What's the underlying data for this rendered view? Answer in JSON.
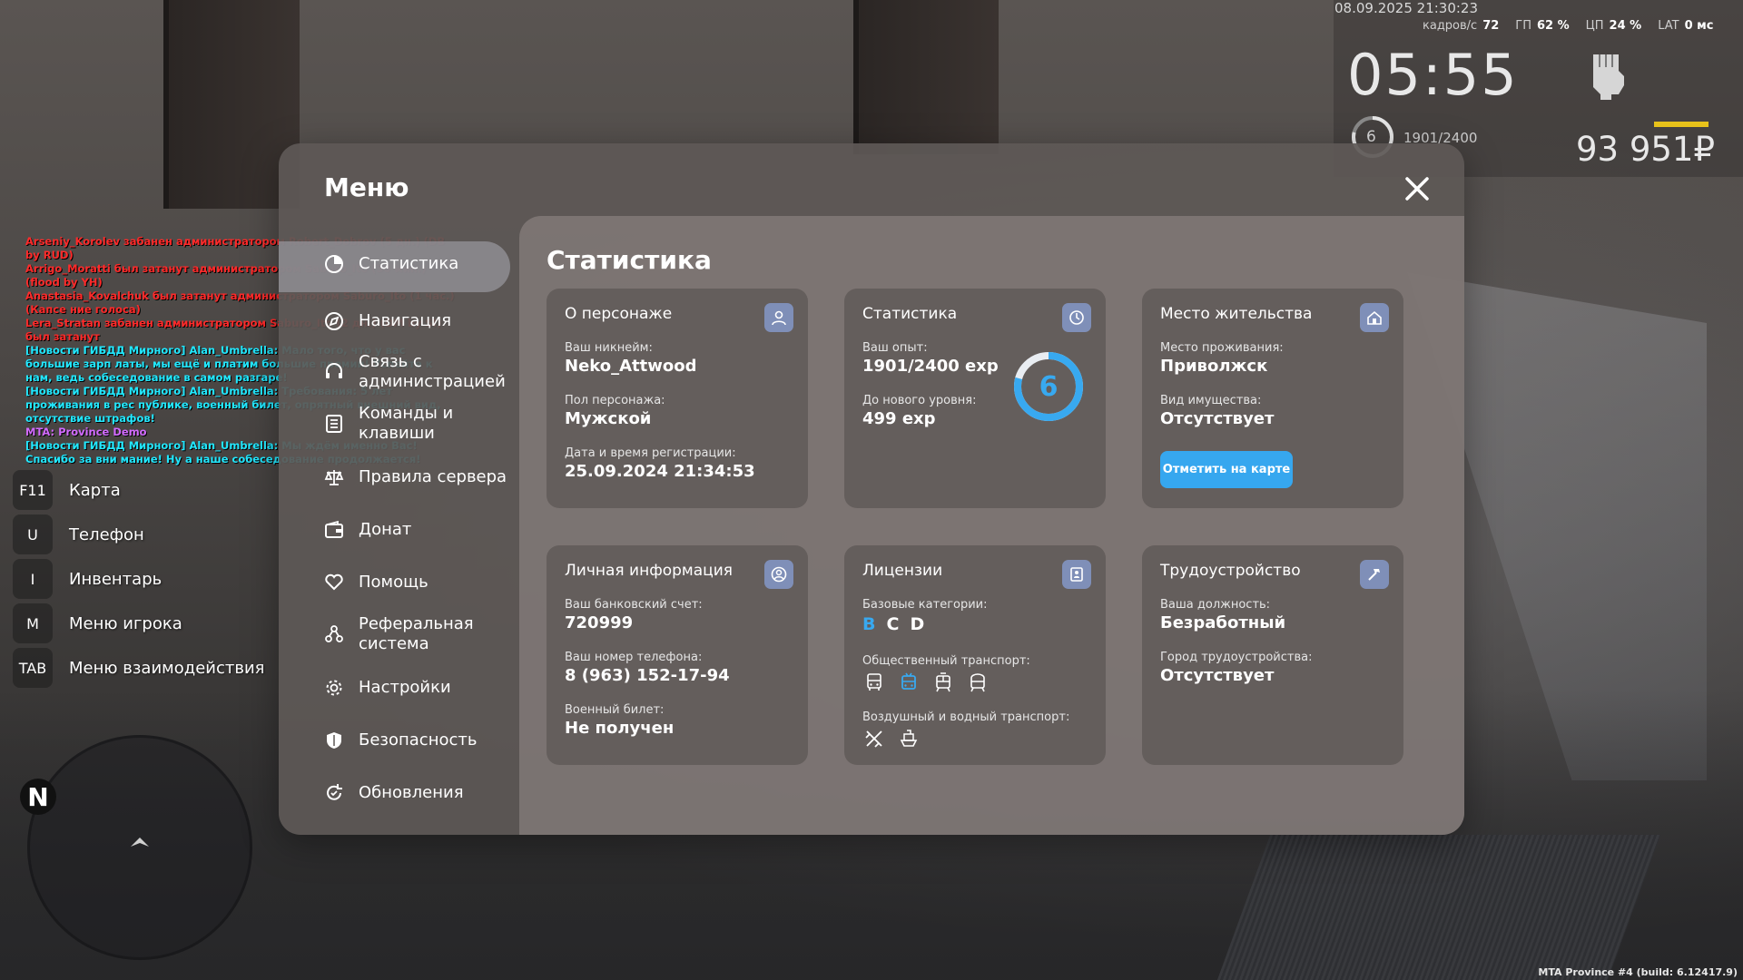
{
  "hud": {
    "datetime": "08.09.2025 21:30:23",
    "fps_label": "кадров/с",
    "fps": "72",
    "gpu_label": "ГП",
    "gpu": "62 %",
    "cpu_label": "ЦП",
    "cpu": "24 %",
    "lat_label": "LAT",
    "lat": "0 мс",
    "time": "05:55",
    "level": "6",
    "exp": "1901/2400",
    "money": "93 951₽"
  },
  "chat": [
    {
      "color": "#ff2a2a",
      "text": "Arseniy_Korolev забанен администратором Robert_Dobrov (5 дн.) (DB by RUD)"
    },
    {
      "color": "#ff2a2a",
      "text": "Arrigo_Moratti был затанут администратором Saburo_Ito (30 мин.) (flood by YH)"
    },
    {
      "color": "#ff2a2a",
      "text": "Anastasia_Kovalchuk был затанут администратором Saburo_Ito (1 час.) (Капсе ние голоса)"
    },
    {
      "color": "#ff2a2a",
      "text": "Lera_Stratan забанен администратором Saburo_Ito (2 дн.) (DM by SI) был затанут"
    },
    {
      "color": "#22e8ff",
      "text": "[Новости ГИБДД Мирного] Alan_Umbrella: Мало того, что у вас большие зарп латы, мы ещё и платим большие премии! Успейте к нам, ведь собеседование в самом разгаре!"
    },
    {
      "color": "#22e8ff",
      "text": "[Новости ГИБДД Мирного] Alan_Umbrella: Требования: 5 лет проживания в рес публике, военный билет, опрятный внешний вид, отсутствие штрафов!"
    },
    {
      "color": "#d26aff",
      "text": "MTA: Province Demo"
    },
    {
      "color": "#22e8ff",
      "text": "[Новости ГИБДД Мирного] Alan_Umbrella: Мы ждём именно Вас! Спасибо за вни мание! Ну а наше собеседование продолжается!"
    }
  ],
  "hotkeys": [
    {
      "key": "F11",
      "label": "Карта"
    },
    {
      "key": "U",
      "label": "Телефон"
    },
    {
      "key": "I",
      "label": "Инвентарь"
    },
    {
      "key": "M",
      "label": "Меню игрока"
    },
    {
      "key": "TAB",
      "label": "Меню взаимодействия"
    }
  ],
  "minimap": {
    "north": "N"
  },
  "footer": "MTA Province #4 (build: 6.12417.9)",
  "menu": {
    "title": "Меню",
    "sidebar": [
      {
        "label": "Статистика",
        "icon": "stats-icon"
      },
      {
        "label": "Навигация",
        "icon": "compass-icon"
      },
      {
        "label": "Связь с администрацией",
        "icon": "headset-icon"
      },
      {
        "label": "Команды и клавиши",
        "icon": "list-icon"
      },
      {
        "label": "Правила сервера",
        "icon": "scales-icon"
      },
      {
        "label": "Донат",
        "icon": "wallet-icon"
      },
      {
        "label": "Помощь",
        "icon": "heart-hands-icon"
      },
      {
        "label": "Реферальная система",
        "icon": "referral-icon"
      },
      {
        "label": "Настройки",
        "icon": "gear-icon"
      },
      {
        "label": "Безопасность",
        "icon": "shield-icon"
      },
      {
        "label": "Обновления",
        "icon": "refresh-icon"
      }
    ],
    "content_title": "Статистика",
    "about": {
      "title": "О персонаже",
      "nick_label": "Ваш никнейм:",
      "nick": "Neko_Attwood",
      "gender_label": "Пол персонажа:",
      "gender": "Мужской",
      "reg_label": "Дата и время регистрации:",
      "reg": "25.09.2024 21:34:53"
    },
    "stats": {
      "title": "Статистика",
      "exp_label": "Ваш опыт:",
      "exp": "1901/2400 exp",
      "next_label": "До нового уровня:",
      "next": "499 exp",
      "level": "6",
      "progress": 0.792
    },
    "home": {
      "title": "Место жительства",
      "place_label": "Место проживания:",
      "place": "Приволжск",
      "property_label": "Вид имущества:",
      "property": "Отсутствует",
      "button": "Отметить на карте"
    },
    "personal": {
      "title": "Личная информация",
      "bank_label": "Ваш банковский счет:",
      "bank": "720999",
      "phone_label": "Ваш номер телефона:",
      "phone": "8 (963) 152-17-94",
      "military_label": "Военный билет:",
      "military": "Не получен"
    },
    "licenses": {
      "title": "Лицензии",
      "base_label": "Базовые категории:",
      "cats": [
        {
          "name": "B",
          "color": "#38a9f0"
        },
        {
          "name": "C",
          "color": "#ffffff"
        },
        {
          "name": "D",
          "color": "#ffffff"
        }
      ],
      "public_label": "Общественный транспорт:",
      "public_icons": [
        "bus-icon",
        "trolleybus-icon",
        "tram-icon",
        "metro-icon"
      ],
      "air_label": "Воздушный и водный транспорт:",
      "air_icons": [
        "plane-icon",
        "ship-icon"
      ]
    },
    "job": {
      "title": "Трудоустройство",
      "position_label": "Ваша должность:",
      "position": "Безработный",
      "city_label": "Город трудоустройства:",
      "city": "Отсутствует"
    }
  }
}
